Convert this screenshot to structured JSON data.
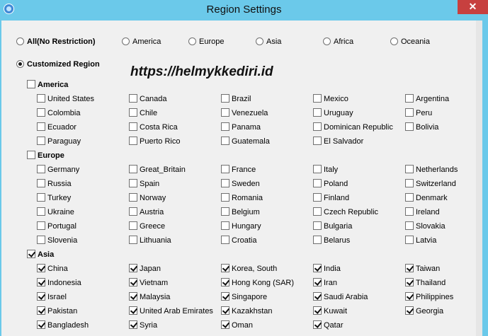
{
  "window": {
    "title": "Region Settings",
    "close_label": "✕"
  },
  "watermark": "https://helmykkediri.id",
  "radios": {
    "all": {
      "label": "All(No Restriction)",
      "selected": false
    },
    "america": {
      "label": "America",
      "selected": false
    },
    "europe": {
      "label": "Europe",
      "selected": false
    },
    "asia": {
      "label": "Asia",
      "selected": false
    },
    "africa": {
      "label": "Africa",
      "selected": false
    },
    "oceania": {
      "label": "Oceania",
      "selected": false
    },
    "customized": {
      "label": "Customized Region",
      "selected": true
    }
  },
  "groups": [
    {
      "name": "America",
      "checked": false,
      "countries": [
        {
          "label": "United States",
          "checked": false
        },
        {
          "label": "Canada",
          "checked": false
        },
        {
          "label": "Brazil",
          "checked": false
        },
        {
          "label": "Mexico",
          "checked": false
        },
        {
          "label": "Argentina",
          "checked": false
        },
        {
          "label": "Colombia",
          "checked": false
        },
        {
          "label": "Chile",
          "checked": false
        },
        {
          "label": "Venezuela",
          "checked": false
        },
        {
          "label": "Uruguay",
          "checked": false
        },
        {
          "label": "Peru",
          "checked": false
        },
        {
          "label": "Ecuador",
          "checked": false
        },
        {
          "label": "Costa Rica",
          "checked": false
        },
        {
          "label": "Panama",
          "checked": false
        },
        {
          "label": "Dominican Republic",
          "checked": false
        },
        {
          "label": "Bolivia",
          "checked": false
        },
        {
          "label": "Paraguay",
          "checked": false
        },
        {
          "label": "Puerto Rico",
          "checked": false
        },
        {
          "label": "Guatemala",
          "checked": false
        },
        {
          "label": "El Salvador",
          "checked": false
        }
      ]
    },
    {
      "name": "Europe",
      "checked": false,
      "countries": [
        {
          "label": "Germany",
          "checked": false
        },
        {
          "label": "Great_Britain",
          "checked": false
        },
        {
          "label": "France",
          "checked": false
        },
        {
          "label": "Italy",
          "checked": false
        },
        {
          "label": "Netherlands",
          "checked": false
        },
        {
          "label": "Russia",
          "checked": false
        },
        {
          "label": "Spain",
          "checked": false
        },
        {
          "label": "Sweden",
          "checked": false
        },
        {
          "label": "Poland",
          "checked": false
        },
        {
          "label": "Switzerland",
          "checked": false
        },
        {
          "label": "Turkey",
          "checked": false
        },
        {
          "label": "Norway",
          "checked": false
        },
        {
          "label": "Romania",
          "checked": false
        },
        {
          "label": "Finland",
          "checked": false
        },
        {
          "label": "Denmark",
          "checked": false
        },
        {
          "label": "Ukraine",
          "checked": false
        },
        {
          "label": "Austria",
          "checked": false
        },
        {
          "label": "Belgium",
          "checked": false
        },
        {
          "label": "Czech Republic",
          "checked": false
        },
        {
          "label": "Ireland",
          "checked": false
        },
        {
          "label": "Portugal",
          "checked": false
        },
        {
          "label": "Greece",
          "checked": false
        },
        {
          "label": "Hungary",
          "checked": false
        },
        {
          "label": "Bulgaria",
          "checked": false
        },
        {
          "label": "Slovakia",
          "checked": false
        },
        {
          "label": "Slovenia",
          "checked": false
        },
        {
          "label": "Lithuania",
          "checked": false
        },
        {
          "label": "Croatia",
          "checked": false
        },
        {
          "label": "Belarus",
          "checked": false
        },
        {
          "label": "Latvia",
          "checked": false
        }
      ]
    },
    {
      "name": "Asia",
      "checked": true,
      "countries": [
        {
          "label": "China",
          "checked": true
        },
        {
          "label": "Japan",
          "checked": true
        },
        {
          "label": "Korea, South",
          "checked": true
        },
        {
          "label": "India",
          "checked": true
        },
        {
          "label": "Taiwan",
          "checked": true
        },
        {
          "label": "Indonesia",
          "checked": true
        },
        {
          "label": "Vietnam",
          "checked": true
        },
        {
          "label": "Hong Kong (SAR)",
          "checked": true
        },
        {
          "label": "Iran",
          "checked": true
        },
        {
          "label": "Thailand",
          "checked": true
        },
        {
          "label": "Israel",
          "checked": true
        },
        {
          "label": "Malaysia",
          "checked": true
        },
        {
          "label": "Singapore",
          "checked": true
        },
        {
          "label": "Saudi Arabia",
          "checked": true
        },
        {
          "label": "Philippines",
          "checked": true
        },
        {
          "label": "Pakistan",
          "checked": true
        },
        {
          "label": "United Arab Emirates",
          "checked": true
        },
        {
          "label": "Kazakhstan",
          "checked": true
        },
        {
          "label": "Kuwait",
          "checked": true
        },
        {
          "label": "Georgia",
          "checked": true
        },
        {
          "label": "Bangladesh",
          "checked": true
        },
        {
          "label": "Syria",
          "checked": true
        },
        {
          "label": "Oman",
          "checked": true
        },
        {
          "label": "Qatar",
          "checked": true
        }
      ]
    }
  ]
}
